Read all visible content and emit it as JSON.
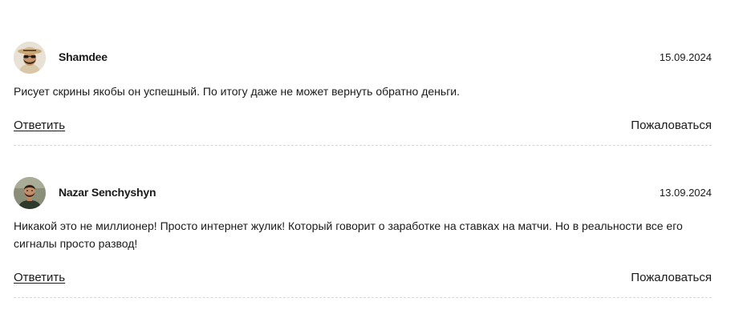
{
  "comments": [
    {
      "author": "Shamdee",
      "date": "15.09.2024",
      "text": "Рисует скрины якобы он успешный. По итогу даже не может вернуть обратно деньги.",
      "reply_label": "Ответить",
      "report_label": "Пожаловаться",
      "avatar_icon": "user-photo-hat-sunglasses"
    },
    {
      "author": "Nazar Senchyshyn",
      "date": "13.09.2024",
      "text": "Никакой это не миллионер! Просто интернет жулик! Который говорит о заработке на ставках на матчи. Но в реальности все его сигналы просто развод!",
      "reply_label": "Ответить",
      "report_label": "Пожаловаться",
      "avatar_icon": "user-photo"
    }
  ],
  "colors": {
    "text": "#1a1a1a",
    "divider": "#d6d6d6",
    "background": "#ffffff"
  }
}
